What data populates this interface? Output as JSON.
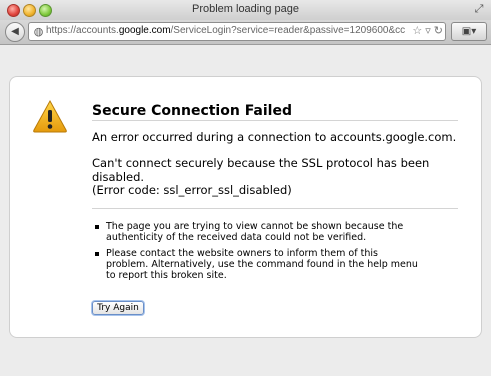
{
  "window": {
    "title": "Problem loading page"
  },
  "toolbar": {
    "url_prefix": "https://accounts.",
    "url_host": "google.com",
    "url_rest": "/ServiceLogin?service=reader&passive=1209600&cc"
  },
  "error": {
    "title": "Secure Connection Failed",
    "line1": "An error occurred during a connection to accounts.google.com.",
    "line2": "Can't connect securely because the SSL protocol has been disabled.",
    "line3": "(Error code: ssl_error_ssl_disabled)",
    "bullets": [
      "The page you are trying to view cannot be shown because the authenticity of the received data could not be verified.",
      "Please contact the website owners to inform them of this problem. Alternatively, use the command found in the help menu to report this broken site."
    ],
    "try_again": "Try Again"
  },
  "colors": {
    "warning": "#f2b31a",
    "button_focus": "#6a8fc8"
  }
}
